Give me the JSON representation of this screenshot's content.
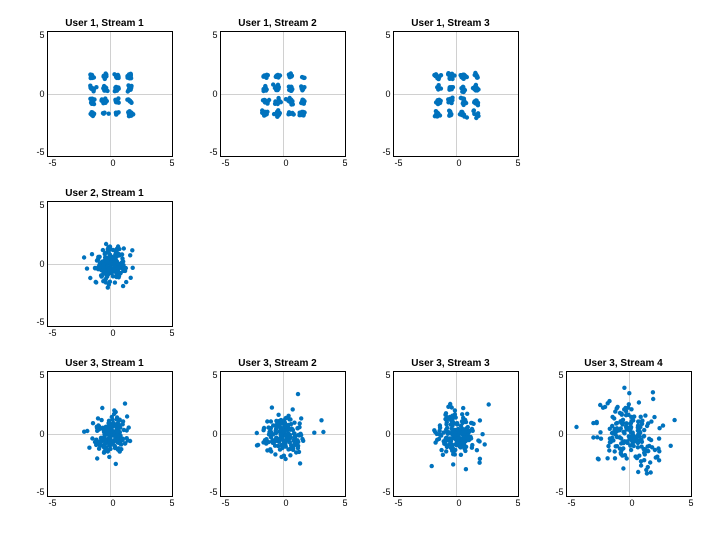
{
  "chart_data": [
    {
      "row": 0,
      "col": 0,
      "title": "User 1, Stream 1",
      "type": "scatter",
      "xlim": [
        -5,
        5
      ],
      "ylim": [
        -5,
        5
      ],
      "xticks": [
        -5,
        0,
        5
      ],
      "yticks": [
        -5,
        0,
        5
      ],
      "spread": 0.3,
      "pattern": "qam16",
      "outliers": 0
    },
    {
      "row": 0,
      "col": 1,
      "title": "User 1, Stream 2",
      "type": "scatter",
      "xlim": [
        -5,
        5
      ],
      "ylim": [
        -5,
        5
      ],
      "xticks": [
        -5,
        0,
        5
      ],
      "yticks": [
        -5,
        0,
        5
      ],
      "spread": 0.33,
      "pattern": "qam16",
      "outliers": 0
    },
    {
      "row": 0,
      "col": 2,
      "title": "User 1, Stream 3",
      "type": "scatter",
      "xlim": [
        -5,
        5
      ],
      "ylim": [
        -5,
        5
      ],
      "xticks": [
        -5,
        0,
        5
      ],
      "yticks": [
        -5,
        0,
        5
      ],
      "spread": 0.36,
      "pattern": "qam16",
      "outliers": 0
    },
    {
      "row": 1,
      "col": 0,
      "title": "User 2, Stream 1",
      "type": "scatter",
      "xlim": [
        -5,
        5
      ],
      "ylim": [
        -5,
        5
      ],
      "xticks": [
        -5,
        0,
        5
      ],
      "yticks": [
        -5,
        0,
        5
      ],
      "spread": 0.38,
      "pattern": "dense",
      "outliers": 0
    },
    {
      "row": 2,
      "col": 0,
      "title": "User 3, Stream 1",
      "type": "scatter",
      "xlim": [
        -5,
        5
      ],
      "ylim": [
        -5,
        5
      ],
      "xticks": [
        -5,
        0,
        5
      ],
      "yticks": [
        -5,
        0,
        5
      ],
      "spread": 0.42,
      "pattern": "dense",
      "outliers": 2
    },
    {
      "row": 2,
      "col": 1,
      "title": "User 3, Stream 2",
      "type": "scatter",
      "xlim": [
        -5,
        5
      ],
      "ylim": [
        -5,
        5
      ],
      "xticks": [
        -5,
        0,
        5
      ],
      "yticks": [
        -5,
        0,
        5
      ],
      "spread": 0.46,
      "pattern": "dense",
      "outliers": 4
    },
    {
      "row": 2,
      "col": 2,
      "title": "User 3, Stream 3",
      "type": "scatter",
      "xlim": [
        -5,
        5
      ],
      "ylim": [
        -5,
        5
      ],
      "xticks": [
        -5,
        0,
        5
      ],
      "yticks": [
        -5,
        0,
        5
      ],
      "spread": 0.5,
      "pattern": "dense",
      "outliers": 6
    },
    {
      "row": 2,
      "col": 3,
      "title": "User 3, Stream 4",
      "type": "scatter",
      "xlim": [
        -5,
        5
      ],
      "ylim": [
        -5,
        5
      ],
      "xticks": [
        -5,
        0,
        5
      ],
      "yticks": [
        -5,
        0,
        5
      ],
      "spread": 0.7,
      "pattern": "dense",
      "outliers": 14
    }
  ],
  "dimensions": {
    "plotWidth": 126,
    "plotHeight": 126,
    "markerR": 2.2,
    "pointCount": 180
  },
  "colors": {
    "marker": "#0072BD"
  }
}
